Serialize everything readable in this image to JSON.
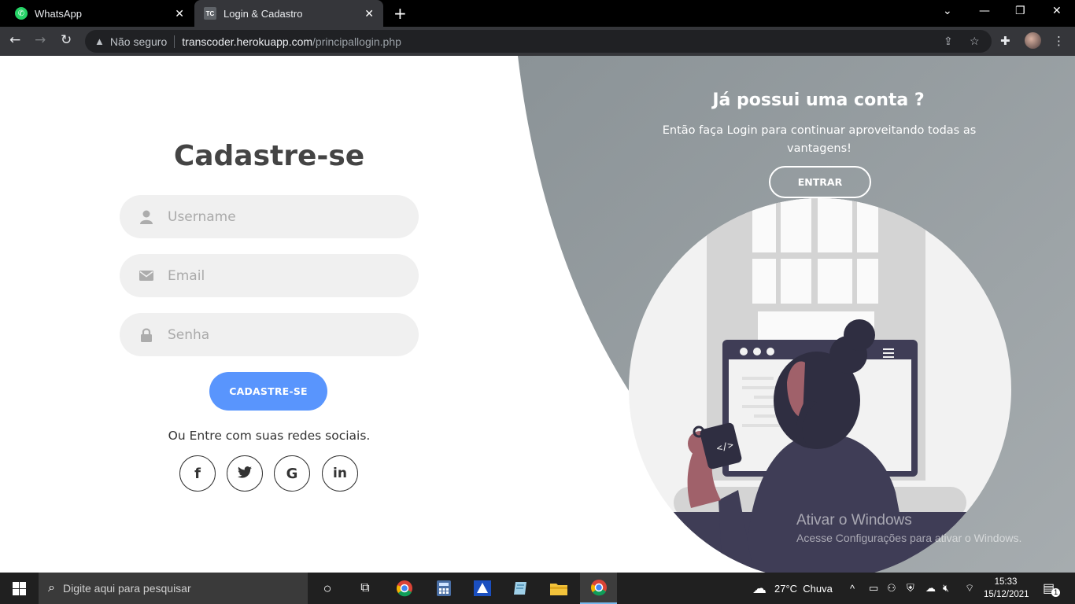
{
  "browser": {
    "tabs": [
      {
        "title": "WhatsApp"
      },
      {
        "title": "Login & Cadastro"
      }
    ],
    "address": {
      "security_label": "Não seguro",
      "host": "transcoder.herokuapp.com",
      "path": "/principallogin.php"
    }
  },
  "signup": {
    "title": "Cadastre-se",
    "username_placeholder": "Username",
    "email_placeholder": "Email",
    "password_placeholder": "Senha",
    "submit_label": "CADASTRE-SE",
    "social_text": "Ou Entre com suas redes sociais.",
    "social_icons": [
      "facebook-icon",
      "twitter-icon",
      "google-icon",
      "linkedin-icon"
    ]
  },
  "panel": {
    "title": "Já possui uma conta ?",
    "text": "Então faça Login para continuar aproveitando todas as vantagens!",
    "button_label": "ENTRAR"
  },
  "watermark": {
    "line1": "Ativar o Windows",
    "line2": "Acesse Configurações para ativar o Windows."
  },
  "taskbar": {
    "search_placeholder": "Digite aqui para pesquisar",
    "weather": "27°C  Chuva",
    "time": "15:33",
    "date": "15/12/2021",
    "notification_count": "1"
  },
  "colors": {
    "primary": "#5995fd",
    "panel_bg": "#8e969a",
    "chrome_dark": "#35363a"
  }
}
